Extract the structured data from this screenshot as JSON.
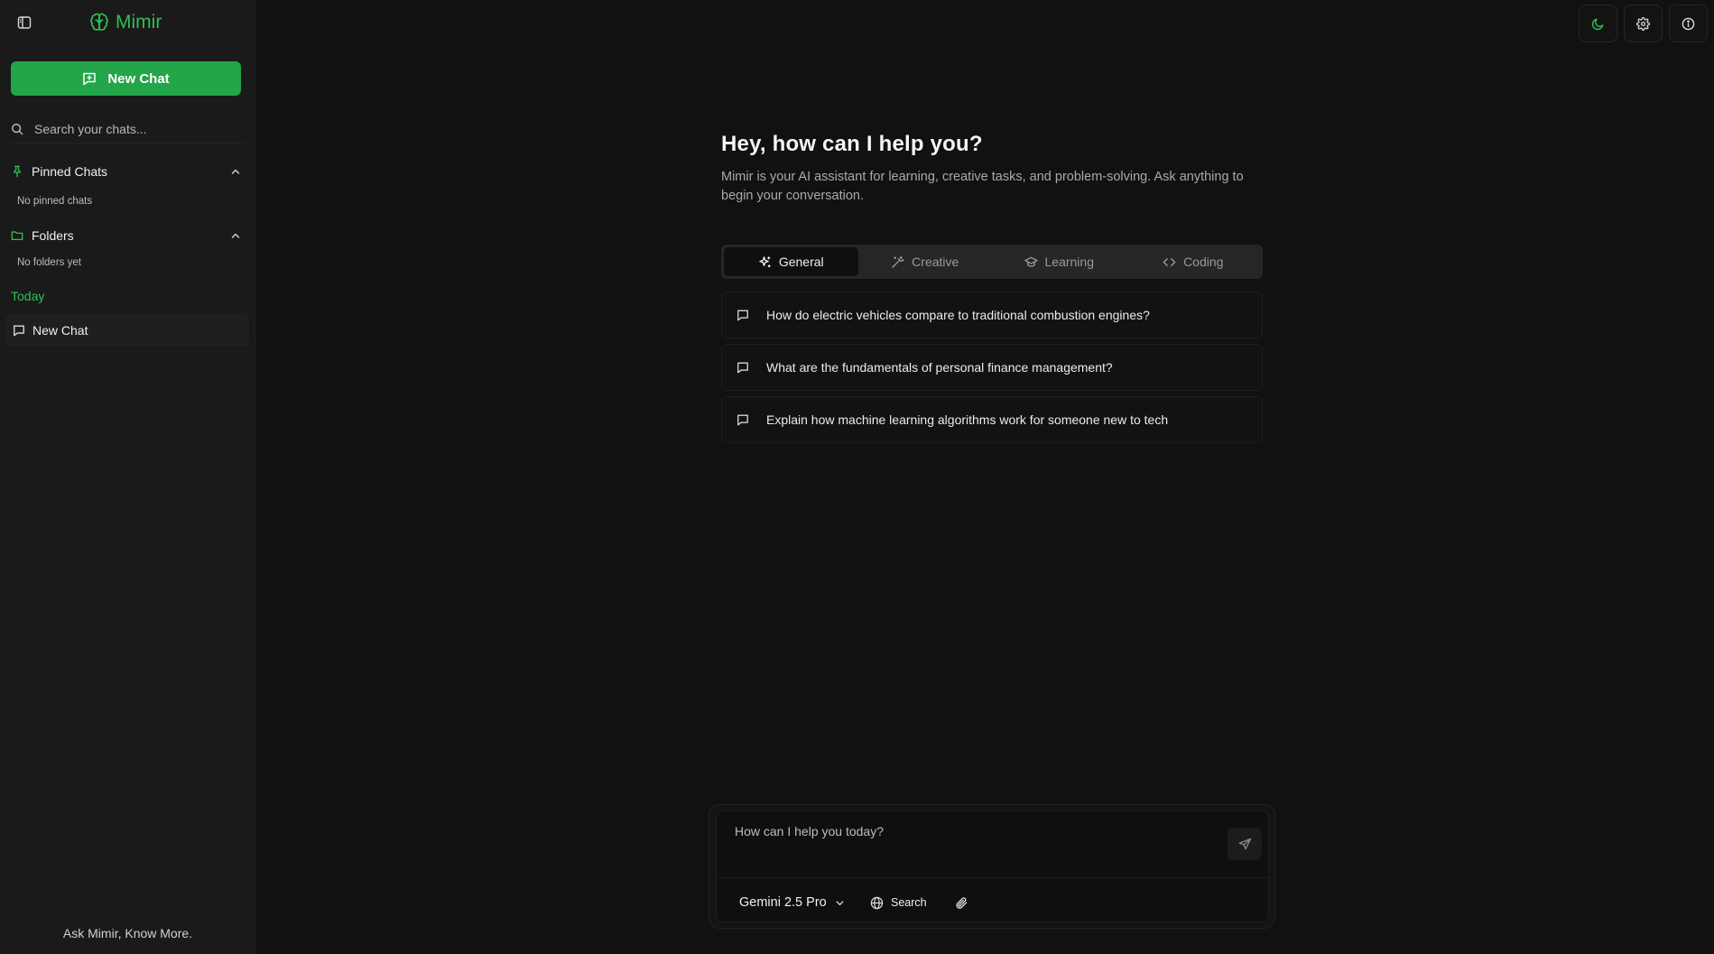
{
  "app": {
    "name": "Mimir",
    "accent_color": "#2fbf55",
    "button_color": "#23a549"
  },
  "sidebar": {
    "toggle_icon": "sidebar-toggle-icon",
    "brand_icon": "brain-icon",
    "new_chat_label": "New Chat",
    "search_placeholder": "Search your chats...",
    "pinned": {
      "label": "Pinned Chats",
      "empty": "No pinned chats"
    },
    "folders": {
      "label": "Folders",
      "empty": "No folders yet"
    },
    "today_label": "Today",
    "chats": [
      {
        "title": "New Chat"
      }
    ],
    "footer": "Ask Mimir, Know More."
  },
  "topbar": {
    "buttons": [
      "moon-icon",
      "gear-icon",
      "info-icon"
    ]
  },
  "welcome": {
    "title": "Hey, how can I help you?",
    "subtitle": "Mimir is your AI assistant for learning, creative tasks, and problem-solving. Ask anything to begin your conversation."
  },
  "tabs": [
    {
      "label": "General",
      "icon": "sparkles-icon",
      "active": true
    },
    {
      "label": "Creative",
      "icon": "magic-wand-icon",
      "active": false
    },
    {
      "label": "Learning",
      "icon": "graduation-cap-icon",
      "active": false
    },
    {
      "label": "Coding",
      "icon": "code-icon",
      "active": false
    }
  ],
  "suggestions": [
    "How do electric vehicles compare to traditional combustion engines?",
    "What are the fundamentals of personal finance management?",
    "Explain how machine learning algorithms work for someone new to tech"
  ],
  "composer": {
    "placeholder": "How can I help you today?",
    "model": "Gemini 2.5 Pro",
    "search_label": "Search"
  }
}
